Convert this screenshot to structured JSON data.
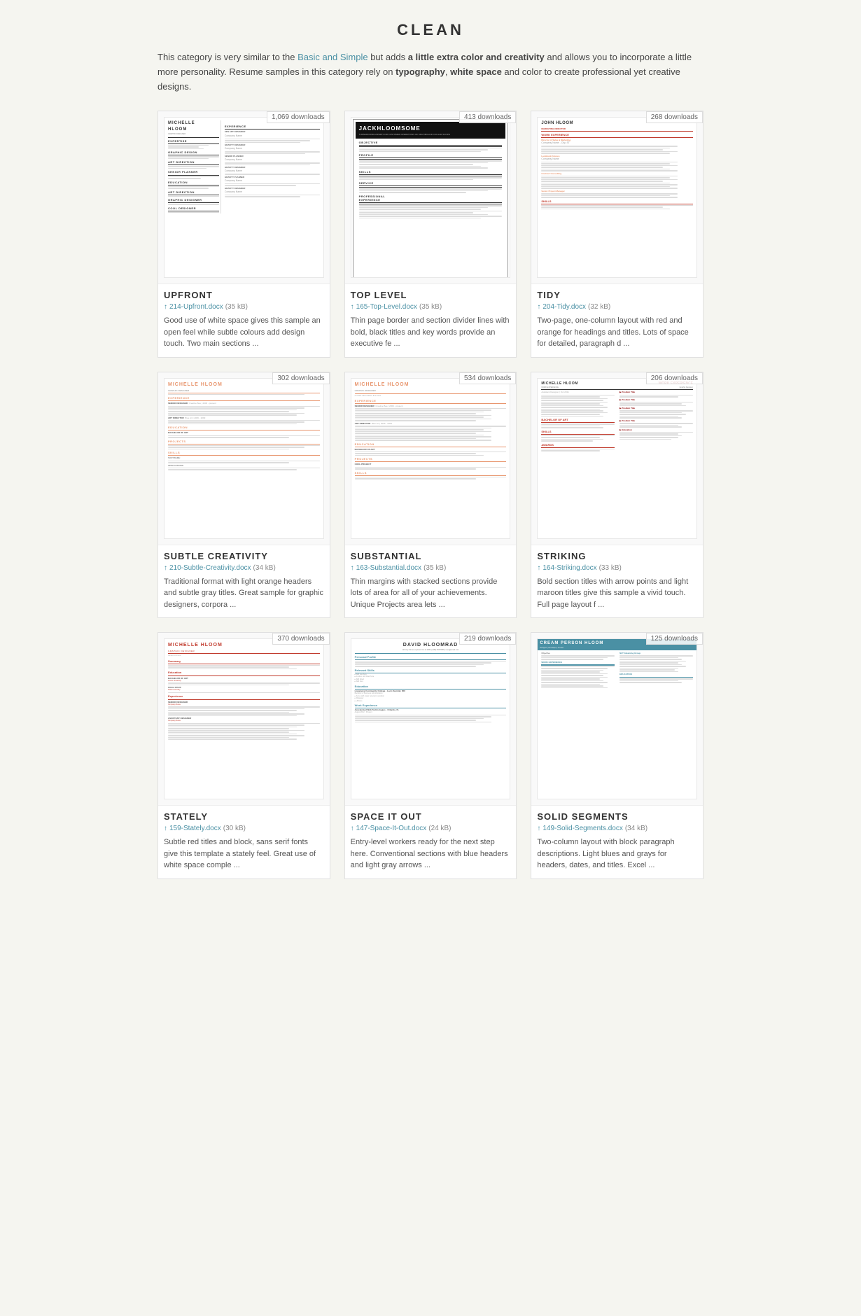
{
  "page": {
    "title": "CLEAN",
    "intro": "This category is very similar to the ",
    "intro_link_text": "Basic and Simple",
    "intro_after": " but adds ",
    "intro_bold1": "a little extra color and creativity",
    "intro_after2": " and allows you to incorporate a little more personality. Resume samples in this category rely on ",
    "intro_bold2": "typography",
    "intro_sep1": ", ",
    "intro_bold3": "white space",
    "intro_after3": " and color to create professional yet creative designs."
  },
  "resumes": [
    {
      "name": "UPFRONT",
      "downloads": "1,069 downloads",
      "file": "214-Upfront.docx",
      "size": "(35 kB)",
      "desc": "Good use of white space gives this sample an open feel while subtle colours add design touch. Two main sections ...",
      "style": "upfront"
    },
    {
      "name": "TOP LEVEL",
      "downloads": "413 downloads",
      "file": "165-Top-Level.docx",
      "size": "(35 kB)",
      "desc": "Thin page border and section divider lines with bold, black titles and key words provide an executive fe ...",
      "style": "toplevel"
    },
    {
      "name": "TIDY",
      "downloads": "268 downloads",
      "file": "204-Tidy.docx",
      "size": "(32 kB)",
      "desc": "Two-page, one-column layout with red and orange for headings and titles. Lots of space for detailed, paragraph d ...",
      "style": "tidy"
    },
    {
      "name": "SUBTLE CREATIVITY",
      "downloads": "302 downloads",
      "file": "210-Subtle-Creativity.docx",
      "size": "(34 kB)",
      "desc": "Traditional format with light orange headers and subtle gray titles. Great sample for graphic designers, corpora ...",
      "style": "subtlecreative"
    },
    {
      "name": "SUBSTANTIAL",
      "downloads": "534 downloads",
      "file": "163-Substantial.docx",
      "size": "(35 kB)",
      "desc": "Thin margins with stacked sections provide lots of area for all of your achievements. Unique Projects area lets ...",
      "style": "substantial"
    },
    {
      "name": "STRIKING",
      "downloads": "206 downloads",
      "file": "164-Striking.docx",
      "size": "(33 kB)",
      "desc": "Bold section titles with arrow points and light maroon titles give this sample a vivid touch. Full page layout f ...",
      "style": "striking"
    },
    {
      "name": "STATELY",
      "downloads": "370 downloads",
      "file": "159-Stately.docx",
      "size": "(30 kB)",
      "desc": "Subtle red titles and block, sans serif fonts give this template a stately feel. Great use of white space comple ...",
      "style": "stately"
    },
    {
      "name": "SPACE IT OUT",
      "downloads": "219 downloads",
      "file": "147-Space-It-Out.docx",
      "size": "(24 kB)",
      "desc": "Entry-level workers ready for the next step here. Conventional sections with blue headers and light gray arrows ...",
      "style": "spaceitout"
    },
    {
      "name": "SOLID SEGMENTS",
      "downloads": "125 downloads",
      "file": "149-Solid-Segments.docx",
      "size": "(34 kB)",
      "desc": "Two-column layout with block paragraph descriptions. Light blues and grays for headers, dates, and titles. Excel ...",
      "style": "solidsegments"
    }
  ]
}
